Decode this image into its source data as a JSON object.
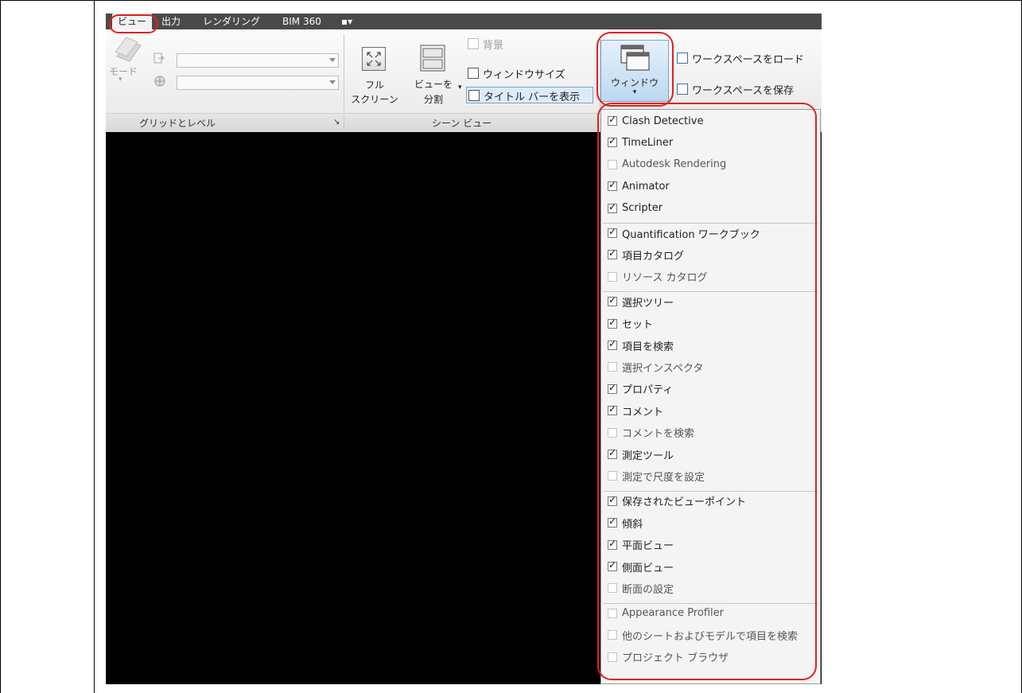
{
  "tabs": [
    "ビュー",
    "出力",
    "レンダリング",
    "BIM 360",
    "▪▾"
  ],
  "ribbon": {
    "grid_panel": {
      "mode_label": "モード",
      "title": "グリッドとレベル",
      "launcher": "↘"
    },
    "scene_panel": {
      "fullscreen_label": [
        "フル",
        "スクリーン"
      ],
      "split_label": [
        "ビューを",
        "分割"
      ],
      "background_label": "背景",
      "window_size_label": "ウィンドウサイズ",
      "title_bar_label": "タイトル バーを表示",
      "title": "シーン ビュー"
    },
    "window_label": "ウィンドウ",
    "load_workspace_label": "ワークスペースをロード",
    "save_workspace_label": "ワークスペースを保存"
  },
  "window_menu": {
    "groups": [
      [
        {
          "label": "Clash Detective",
          "checked": true
        },
        {
          "label": "TimeLiner",
          "checked": true
        },
        {
          "label": "Autodesk Rendering",
          "checked": false
        },
        {
          "label": "Animator",
          "checked": true
        },
        {
          "label": "Scripter",
          "checked": true
        }
      ],
      [
        {
          "label": "Quantification ワークブック",
          "checked": true
        },
        {
          "label": "項目カタログ",
          "checked": true
        },
        {
          "label": "リソース カタログ",
          "checked": false
        }
      ],
      [
        {
          "label": "選択ツリー",
          "checked": true
        },
        {
          "label": "セット",
          "checked": true
        },
        {
          "label": "項目を検索",
          "checked": true
        },
        {
          "label": "選択インスペクタ",
          "checked": false
        },
        {
          "label": "プロパティ",
          "checked": true
        },
        {
          "label": "コメント",
          "checked": true
        },
        {
          "label": "コメントを検索",
          "checked": false
        },
        {
          "label": "測定ツール",
          "checked": true
        },
        {
          "label": "測定で尺度を設定",
          "checked": false
        }
      ],
      [
        {
          "label": "保存されたビューポイント",
          "checked": true
        },
        {
          "label": "傾斜",
          "checked": true
        },
        {
          "label": "平面ビュー",
          "checked": true
        },
        {
          "label": "側面ビュー",
          "checked": true
        },
        {
          "label": "断面の設定",
          "checked": false
        }
      ],
      [
        {
          "label": "Appearance Profiler",
          "checked": false
        },
        {
          "label": "他のシートおよびモデルで項目を検索",
          "checked": false
        },
        {
          "label": "プロジェクト ブラウザ",
          "checked": false
        }
      ]
    ]
  },
  "colors": {
    "annotation": "#e02020",
    "ribbon_dark": "#4a4a4a",
    "highlight": "#bcd8f1"
  }
}
